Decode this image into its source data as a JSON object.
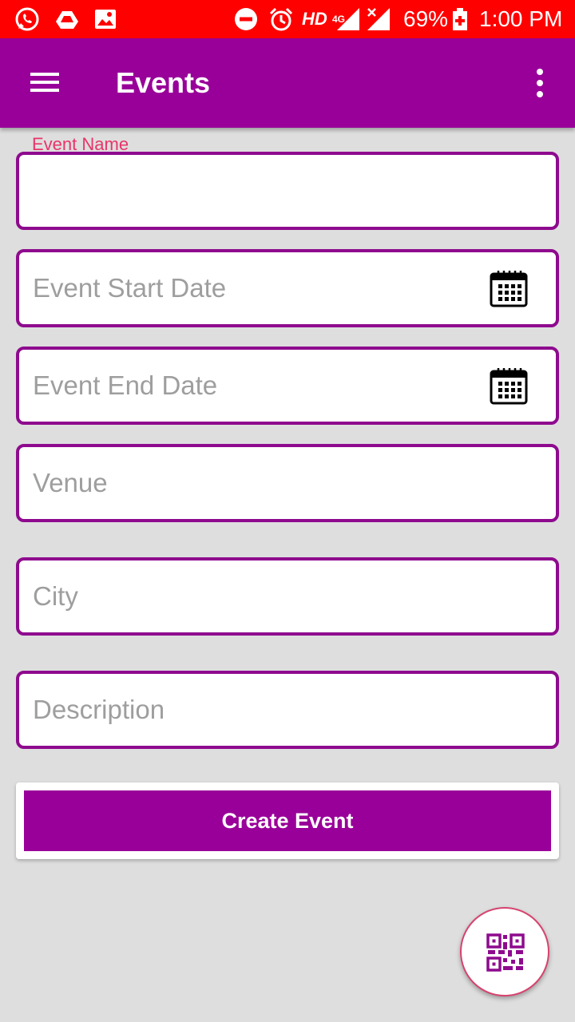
{
  "status_bar": {
    "network": "HD",
    "network_gen": "4G",
    "battery": "69%",
    "time": "1:00 PM",
    "icons": [
      "whatsapp-icon",
      "drive-icon",
      "image-icon",
      "do-not-disturb-icon",
      "alarm-icon",
      "signal-icon",
      "no-signal-icon",
      "battery-charging-icon"
    ]
  },
  "app_bar": {
    "title": "Events",
    "menu_icon": "hamburger-menu-icon",
    "overflow_icon": "more-vert-icon",
    "color": "#990099"
  },
  "form": {
    "event_name": {
      "label": "Event Name",
      "value": ""
    },
    "start_date": {
      "placeholder": "Event Start Date",
      "icon": "calendar-icon"
    },
    "end_date": {
      "placeholder": "Event End Date",
      "icon": "calendar-icon"
    },
    "venue": {
      "placeholder": "Venue"
    },
    "city": {
      "placeholder": "City"
    },
    "description": {
      "placeholder": "Description"
    }
  },
  "create_button": {
    "label": "Create Event"
  },
  "fab": {
    "icon": "qr-code-icon"
  },
  "colors": {
    "accent": "#990099",
    "status_bar": "#ff0000",
    "label": "#e8356a",
    "border": "#8e0a8e",
    "background": "#dedede"
  }
}
